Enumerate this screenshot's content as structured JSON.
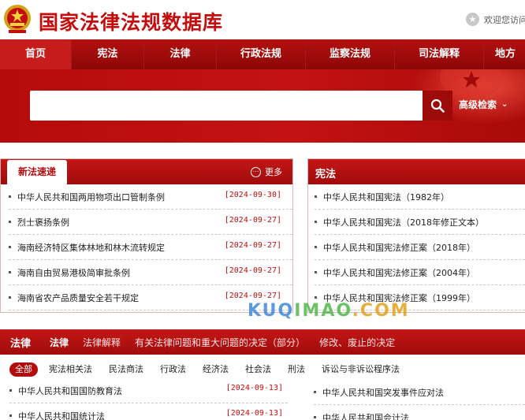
{
  "header": {
    "site_title": "国家法律法规数据库",
    "welcome": "欢迎您访问"
  },
  "nav": {
    "items": [
      "首页",
      "宪法",
      "法律",
      "行政法规",
      "监察法规",
      "司法解释",
      "地方"
    ],
    "active_index": 0
  },
  "search": {
    "value": "",
    "placeholder": "",
    "advanced_label": "高级检索"
  },
  "news_panel": {
    "tab_label": "新法速递",
    "more_label": "更多",
    "items": [
      {
        "title": "中华人民共和国两用物项出口管制条例",
        "date": "[2024-09-30]"
      },
      {
        "title": "烈士褒扬条例",
        "date": "[2024-09-27]"
      },
      {
        "title": "海南经济特区集体林地和林木流转规定",
        "date": "[2024-09-27]"
      },
      {
        "title": "海南自由贸易港极简审批条例",
        "date": "[2024-09-27]"
      },
      {
        "title": "海南省农产品质量安全若干规定",
        "date": "[2024-09-27]"
      }
    ]
  },
  "constitution_panel": {
    "title": "宪法",
    "items": [
      "中华人民共和国宪法（1982年）",
      "中华人民共和国宪法（2018年修正文本）",
      "中华人民共和国宪法修正案（2018年）",
      "中华人民共和国宪法修正案（2004年）",
      "中华人民共和国宪法修正案（1999年）"
    ]
  },
  "law_panel": {
    "label": "法律",
    "tabs": [
      "法律",
      "法律解释",
      "有关法律问题和重大问题的决定（部分）",
      "修改、废止的决定"
    ],
    "active_tab_index": 0,
    "chips": [
      "全部",
      "宪法相关法",
      "民法商法",
      "行政法",
      "经济法",
      "社会法",
      "刑法",
      "诉讼与非诉讼程序法"
    ],
    "active_chip_index": 0,
    "left_items": [
      {
        "title": "中华人民共和国国防教育法",
        "date": "[2024-09-13]"
      },
      {
        "title": "中华人民共和国统计法",
        "date": "[2024-09-13]"
      }
    ],
    "right_items": [
      "中华人民共和国突发事件应对法",
      "中华人民共和国会计法"
    ]
  },
  "watermark": {
    "part1": "KUQ",
    "part2": "IMAO",
    "part3": ".COM"
  },
  "colors": {
    "brand_red": "#c40e0e",
    "nav_red": "#a00c0c",
    "date_red": "#c40e0e"
  }
}
